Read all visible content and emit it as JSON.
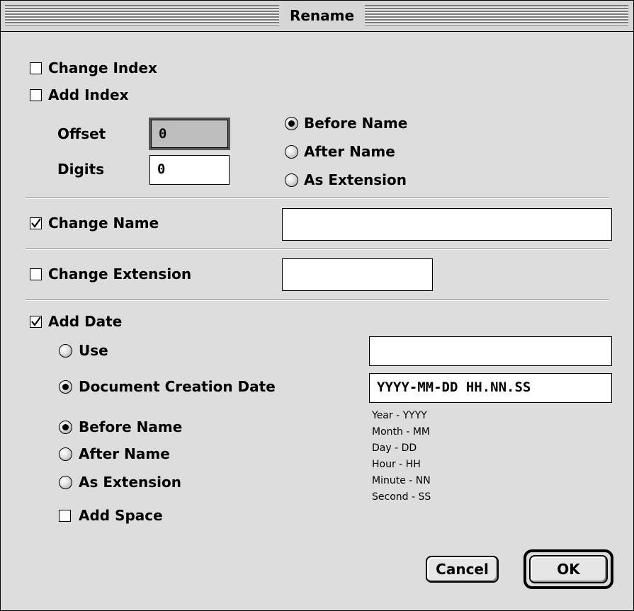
{
  "window": {
    "title": "Rename"
  },
  "index": {
    "change_index_label": "Change Index",
    "change_index_checked": false,
    "add_index_label": "Add Index",
    "add_index_checked": false,
    "offset_label": "Offset",
    "offset_value": "0",
    "digits_label": "Digits",
    "digits_value": "0",
    "positions": [
      {
        "label": "Before Name",
        "selected": true
      },
      {
        "label": "After Name",
        "selected": false
      },
      {
        "label": "As Extension",
        "selected": false
      }
    ]
  },
  "name": {
    "label": "Change Name",
    "checked": true,
    "value": ""
  },
  "extension": {
    "label": "Change Extension",
    "checked": false,
    "value": ""
  },
  "date": {
    "label": "Add Date",
    "checked": true,
    "use_label": "Use",
    "use_selected": false,
    "use_value": "",
    "creation_label": "Document Creation Date",
    "creation_selected": true,
    "format_value": "YYYY-MM-DD HH.NN.SS",
    "legend": [
      "Year - YYYY",
      "Month - MM",
      "Day - DD",
      "Hour - HH",
      "Minute - NN",
      "Second - SS"
    ],
    "positions": [
      {
        "label": "Before Name",
        "selected": true
      },
      {
        "label": "After Name",
        "selected": false
      },
      {
        "label": "As Extension",
        "selected": false
      }
    ],
    "add_space_label": "Add Space",
    "add_space_checked": false
  },
  "buttons": {
    "cancel": "Cancel",
    "ok": "OK"
  }
}
